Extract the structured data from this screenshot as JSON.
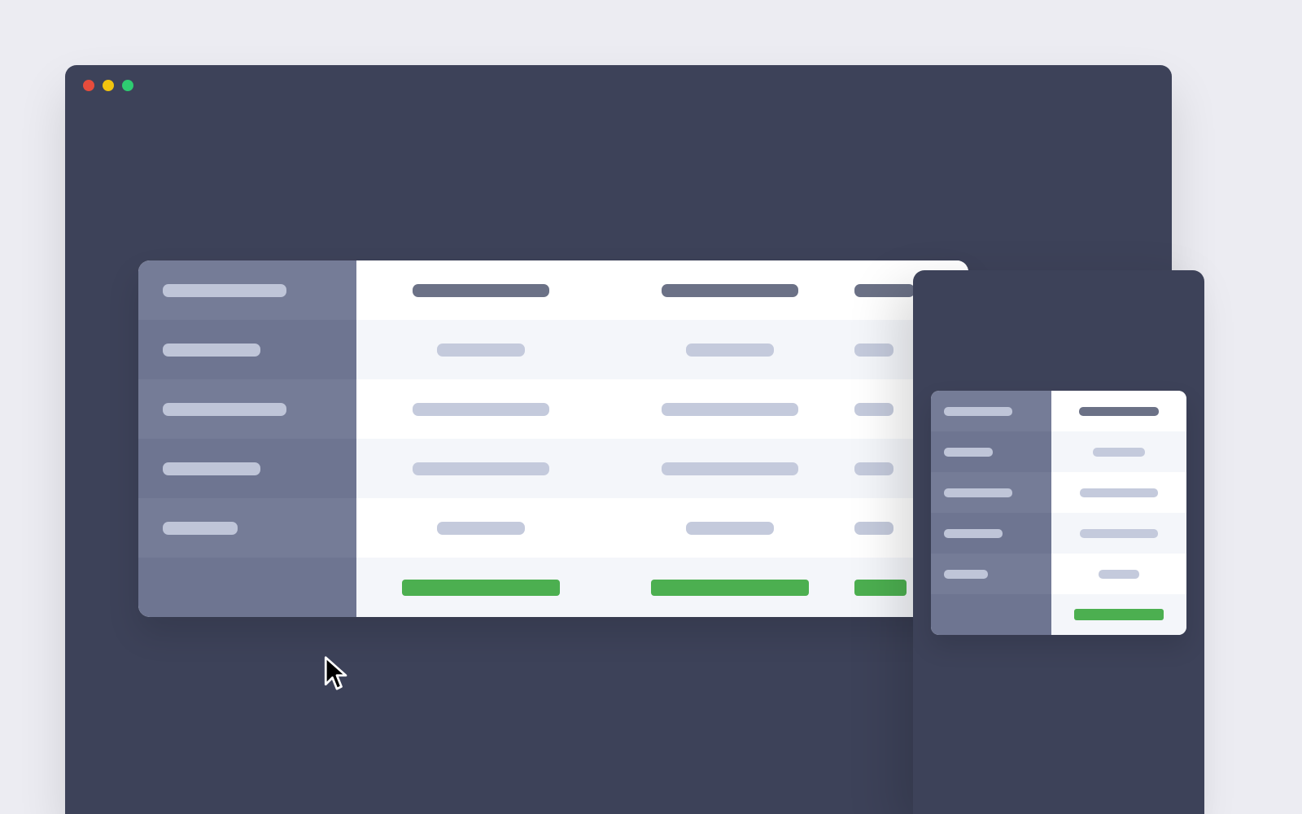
{
  "colors": {
    "page_bg": "#ECECF2",
    "window_bg": "#3D4259",
    "label_col_bg_a": "#757C97",
    "label_col_bg_b": "#6E7591",
    "cell_bg_a": "#FFFFFF",
    "cell_bg_b": "#F4F6FA",
    "placeholder_label": "#BFC5D8",
    "placeholder_header": "#6B7186",
    "placeholder_value": "#C4CADC",
    "cta": "#4CAF50",
    "dot_close": "#E74C3C",
    "dot_minimize": "#F1C40F",
    "dot_maximize": "#2ECC71"
  },
  "window_controls": {
    "close": "close",
    "minimize": "minimize",
    "maximize": "maximize"
  },
  "desktop_table": {
    "feature_labels": [
      "",
      "",
      "",
      "",
      "",
      ""
    ],
    "plans": [
      {
        "header": "",
        "values": [
          "",
          "",
          "",
          ""
        ],
        "cta": ""
      },
      {
        "header": "",
        "values": [
          "",
          "",
          "",
          ""
        ],
        "cta": ""
      },
      {
        "header": "",
        "values": [
          "",
          "",
          "",
          ""
        ],
        "cta": ""
      }
    ]
  },
  "mobile_table": {
    "feature_labels": [
      "",
      "",
      "",
      "",
      "",
      ""
    ],
    "plan": {
      "header": "",
      "values": [
        "",
        "",
        "",
        ""
      ],
      "cta": ""
    }
  },
  "cursor": {
    "name": "pointer-cursor"
  }
}
